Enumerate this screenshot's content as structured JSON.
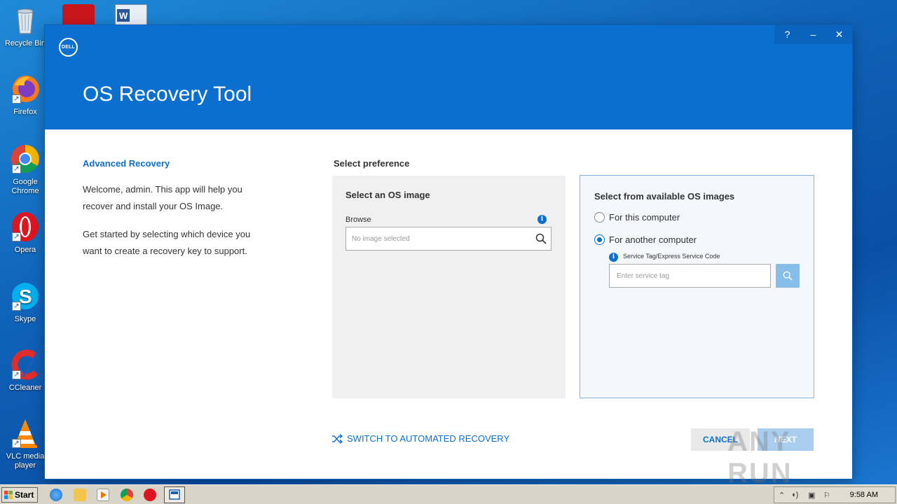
{
  "desktop": {
    "icons": [
      {
        "label": "Recycle Bin"
      },
      {
        "label": "Firefox"
      },
      {
        "label": "Google Chrome"
      },
      {
        "label": "Opera"
      },
      {
        "label": "Skype"
      },
      {
        "label": "CCleaner"
      },
      {
        "label": "VLC media player"
      }
    ]
  },
  "window": {
    "logo_text": "DELL",
    "controls": {
      "help": "?",
      "minimize": "–",
      "close": "✕"
    },
    "title": "OS Recovery Tool"
  },
  "left": {
    "heading": "Advanced Recovery",
    "welcome": "Welcome, admin. This app will help you recover and install your OS Image.",
    "started": "Get started by selecting which device you want to create a recovery key to support."
  },
  "preference": {
    "label": "Select preference",
    "os_image": {
      "title": "Select an OS image",
      "browse_label": "Browse",
      "placeholder": "No image selected"
    },
    "available": {
      "title": "Select from available OS images",
      "option_this": "For this computer",
      "option_another": "For another computer",
      "selected": "another",
      "service_label": "Service Tag/Express Service Code",
      "service_placeholder": "Enter service tag"
    }
  },
  "actions": {
    "switch_label": "SWITCH TO AUTOMATED RECOVERY",
    "cancel": "CANCEL",
    "next": "NEXT"
  },
  "watermark": "ANY RUN",
  "taskbar": {
    "start": "Start",
    "clock": "9:58 AM"
  },
  "colors": {
    "accent": "#0b6fd0",
    "header": "#0b6fd0"
  }
}
